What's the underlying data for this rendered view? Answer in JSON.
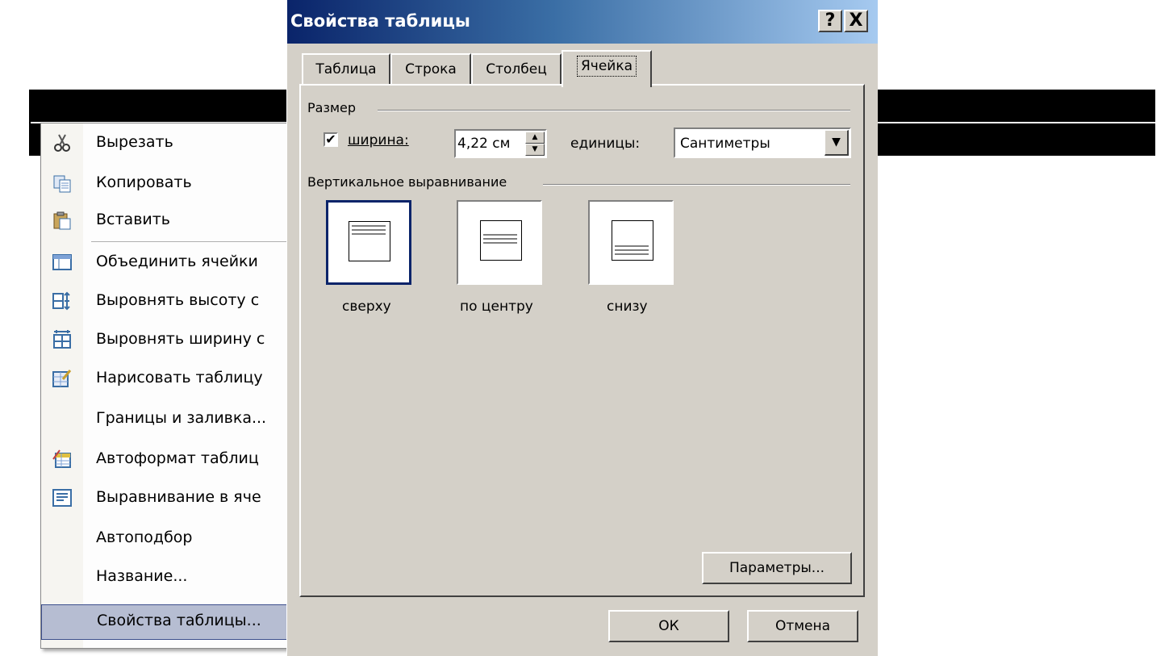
{
  "context_menu": {
    "items": [
      {
        "label": "Вырезать",
        "icon": "scissors-icon"
      },
      {
        "label": "Копировать",
        "icon": "copy-icon"
      },
      {
        "label": "Вставить",
        "icon": "paste-icon"
      },
      {
        "label": "Объединить ячейки",
        "icon": "merge-cells-icon"
      },
      {
        "label": "Выровнять высоту с",
        "icon": "distribute-rows-icon"
      },
      {
        "label": "Выровнять ширину с",
        "icon": "distribute-columns-icon"
      },
      {
        "label": "Нарисовать таблицу",
        "icon": "draw-table-icon"
      },
      {
        "label": "Границы и заливка...",
        "icon": ""
      },
      {
        "label": "Автоформат таблиц",
        "icon": "autoformat-icon"
      },
      {
        "label": "Выравнивание в яче",
        "icon": "cell-alignment-icon"
      },
      {
        "label": "Автоподбор",
        "icon": ""
      },
      {
        "label": "Название...",
        "icon": ""
      },
      {
        "label": "Свойства таблицы...",
        "icon": ""
      }
    ]
  },
  "dialog": {
    "title": "Свойства таблицы",
    "help_button": "?",
    "close_button": "X",
    "tabs": [
      "Таблица",
      "Строка",
      "Столбец",
      "Ячейка"
    ],
    "active_tab": "Ячейка",
    "size_group": "Размер",
    "width_label": "ширина:",
    "width_checked": true,
    "width_value": "4,22 см",
    "units_label": "единицы:",
    "units_value": "Сантиметры",
    "valign_group": "Вертикальное выравнивание",
    "valign_options": [
      "сверху",
      "по центру",
      "снизу"
    ],
    "valign_selected": "сверху",
    "params_button": "Параметры...",
    "ok_button": "ОК",
    "cancel_button": "Отмена"
  },
  "colors": {
    "title_start": "#0a246a",
    "title_end": "#a6caf0",
    "dialog_face": "#d4d0c8",
    "menu_highlight": "#b6bdd2"
  }
}
